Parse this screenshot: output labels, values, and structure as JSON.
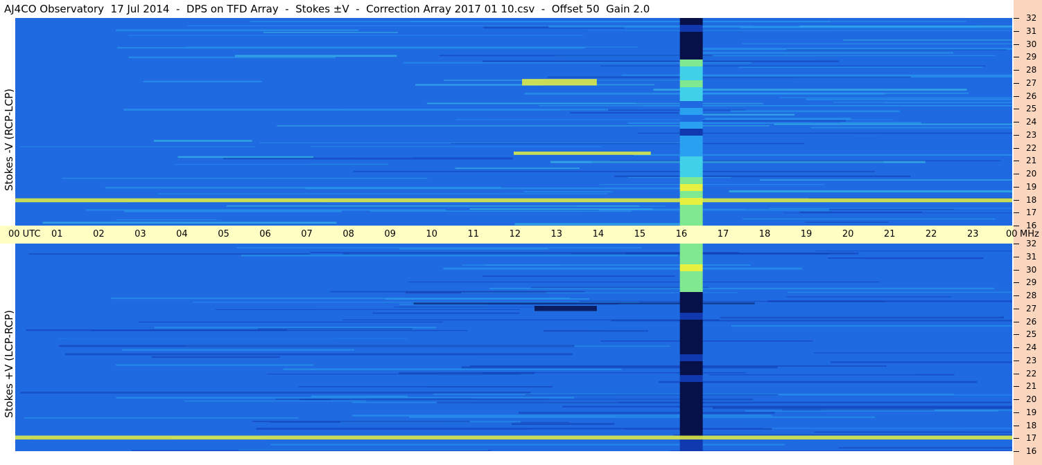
{
  "title": "AJ4CO Observatory  17 Jul 2014  -  DPS on TFD Array  -  Stokes ±V  -  Correction Array 2017 01 10.csv  -  Offset 50  Gain 2.0",
  "chart_data": [
    {
      "type": "heatmap",
      "title": "AJ4CO Observatory  17 Jul 2014  -  DPS on TFD Array  -  Stokes ±V  -  Correction Array 2017 01 10.csv  -  Offset 50  Gain 2.0",
      "ylabel": "Stokes -V (RCP-LCP)",
      "x_ticks": [
        "00 UTC",
        "01",
        "02",
        "03",
        "04",
        "05",
        "06",
        "07",
        "08",
        "09",
        "10",
        "11",
        "12",
        "13",
        "14",
        "15",
        "16",
        "17",
        "18",
        "19",
        "20",
        "21",
        "22",
        "23",
        "00"
      ],
      "y_ticks": [
        "16",
        "17",
        "18",
        "19",
        "20",
        "21",
        "22",
        "23",
        "24",
        "25",
        "26",
        "27",
        "28",
        "29",
        "30",
        "31",
        "32"
      ],
      "y_unit": "MHz",
      "ylim": [
        16,
        32
      ],
      "colormap": [
        "#08104a",
        "#1039b0",
        "#1f6ae0",
        "#2aa0f0",
        "#40d0e8",
        "#7fe890",
        "#e8f040",
        "#ff8030"
      ],
      "background_level": 0.35,
      "features": [
        {
          "name": "event-16utc",
          "time_range": [
            16.0,
            16.55
          ],
          "freq_range": [
            16,
            32
          ],
          "pattern": "strong-bright"
        },
        {
          "name": "band-21.5",
          "time_range": [
            12.0,
            15.3
          ],
          "freq_range": [
            21.45,
            21.7
          ],
          "pattern": "bright"
        },
        {
          "name": "band-27",
          "time_range": [
            12.2,
            14.0
          ],
          "freq_range": [
            26.8,
            27.3
          ],
          "pattern": "bright"
        },
        {
          "name": "rfi-18",
          "time_range": [
            0,
            24
          ],
          "freq_range": [
            17.8,
            18.1
          ],
          "pattern": "bright"
        }
      ]
    },
    {
      "type": "heatmap",
      "ylabel": "Stokes +V (LCP-RCP)",
      "x_ticks": [
        "00 UTC",
        "01",
        "02",
        "03",
        "04",
        "05",
        "06",
        "07",
        "08",
        "09",
        "10",
        "11",
        "12",
        "13",
        "14",
        "15",
        "16",
        "17",
        "18",
        "19",
        "20",
        "21",
        "22",
        "23",
        "00"
      ],
      "y_ticks": [
        "16",
        "17",
        "18",
        "19",
        "20",
        "21",
        "22",
        "23",
        "24",
        "25",
        "26",
        "27",
        "28",
        "29",
        "30",
        "31",
        "32"
      ],
      "y_unit": "MHz",
      "ylim": [
        16,
        32
      ],
      "colormap": [
        "#08104a",
        "#1039b0",
        "#1f6ae0",
        "#2aa0f0",
        "#40d0e8",
        "#7fe890",
        "#e8f040",
        "#ff8030"
      ],
      "background_level": 0.28,
      "features": [
        {
          "name": "event-16utc",
          "time_range": [
            16.0,
            16.55
          ],
          "freq_range": [
            16,
            32
          ],
          "pattern": "dark-with-bright-top"
        },
        {
          "name": "band-27",
          "time_range": [
            12.5,
            14.0
          ],
          "freq_range": [
            26.8,
            27.2
          ],
          "pattern": "dark"
        },
        {
          "name": "rfi-17",
          "time_range": [
            0,
            24
          ],
          "freq_range": [
            16.9,
            17.2
          ],
          "pattern": "bright"
        }
      ]
    }
  ],
  "axis": {
    "time_labels": [
      "00 UTC",
      "01",
      "02",
      "03",
      "04",
      "05",
      "06",
      "07",
      "08",
      "09",
      "10",
      "11",
      "12",
      "13",
      "14",
      "15",
      "16",
      "17",
      "18",
      "19",
      "20",
      "21",
      "22",
      "23",
      "00"
    ],
    "unit_label": "MHz"
  }
}
